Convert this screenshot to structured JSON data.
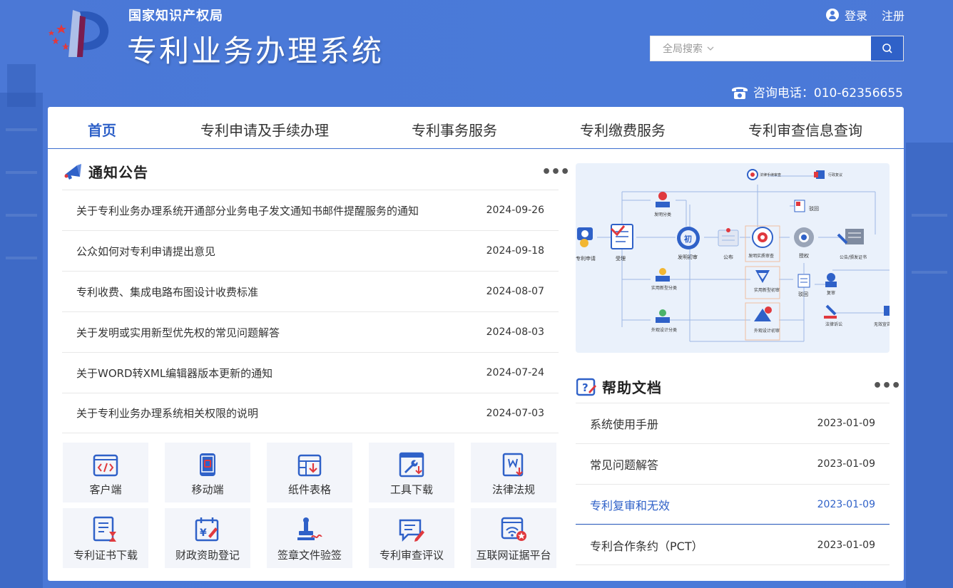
{
  "header": {
    "agency": "国家知识产权局",
    "system_name": "专利业务办理系统",
    "login": "登录",
    "register": "注册",
    "search": {
      "scope": "全局搜索",
      "placeholder": "",
      "scope_icon": "chevron-down-icon",
      "button_icon": "search-icon"
    },
    "hotline": "咨询电话：010-62356655",
    "hotline_icon": "telephone-icon"
  },
  "nav": {
    "items": [
      {
        "label": "首页",
        "active": true
      },
      {
        "label": "专利申请及手续办理"
      },
      {
        "label": "专利事务服务"
      },
      {
        "label": "专利缴费服务"
      },
      {
        "label": "专利审查信息查询"
      }
    ]
  },
  "notices": {
    "title": "通知公告",
    "more": "•••",
    "items": [
      {
        "title": "关于专利业务办理系统开通部分业务电子发文通知书邮件提醒服务的通知",
        "date": "2024-09-26"
      },
      {
        "title": "公众如何对专利申请提出意见",
        "date": "2024-09-18"
      },
      {
        "title": "专利收费、集成电路布图设计收费标准",
        "date": "2024-08-07"
      },
      {
        "title": "关于发明或实用新型优先权的常见问题解答",
        "date": "2024-08-03"
      },
      {
        "title": "关于WORD转XML编辑器版本更新的通知",
        "date": "2024-07-24"
      },
      {
        "title": "关于专利业务办理系统相关权限的说明",
        "date": "2024-07-03"
      }
    ]
  },
  "tiles": [
    {
      "label": "客户端",
      "icon": "code-window-icon"
    },
    {
      "label": "移动端",
      "icon": "mobile-phone-icon"
    },
    {
      "label": "纸件表格",
      "icon": "table-download-icon"
    },
    {
      "label": "工具下载",
      "icon": "tool-download-icon"
    },
    {
      "label": "法律法规",
      "icon": "law-document-icon"
    },
    {
      "label": "专利证书下载",
      "icon": "certificate-hourglass-icon"
    },
    {
      "label": "财政资助登记",
      "icon": "finance-calendar-icon"
    },
    {
      "label": "签章文件验签",
      "icon": "seal-signature-icon"
    },
    {
      "label": "专利审查评议",
      "icon": "comment-edit-icon"
    },
    {
      "label": "互联网证据平台",
      "icon": "network-evidence-icon"
    }
  ],
  "flowchart": {
    "labels": {
      "apply": "专利申请",
      "accept": "受理",
      "invention_class": "发明分类",
      "utility_class": "实用新型分类",
      "design_class": "外观设计分类",
      "preliminary": "发明初审",
      "initial": "初",
      "publish": "公布",
      "substantive": "发明实质审查",
      "grant": "授权",
      "announce": "公告/颁发证书",
      "rejection": "驳回",
      "rejection2": "驳回",
      "utility_prelim": "实用新型初审",
      "design_prelim": "外观设计初审",
      "reexam": "复审",
      "invalid": "无效宣告",
      "litigation": "法律诉讼",
      "procedural": "法律手续审查",
      "administrative": "行政复议"
    }
  },
  "help": {
    "title": "帮助文档",
    "more": "•••",
    "items": [
      {
        "title": "系统使用手册",
        "date": "2023-01-09"
      },
      {
        "title": "常见问题解答",
        "date": "2023-01-09"
      },
      {
        "title": "专利复审和无效",
        "date": "2023-01-09",
        "highlighted": true
      },
      {
        "title": "专利合作条约（PCT）",
        "date": "2023-01-09"
      }
    ]
  },
  "colors": {
    "primary": "#2f61c8",
    "background": "#4a79d8",
    "accent_red": "#e0393e"
  }
}
